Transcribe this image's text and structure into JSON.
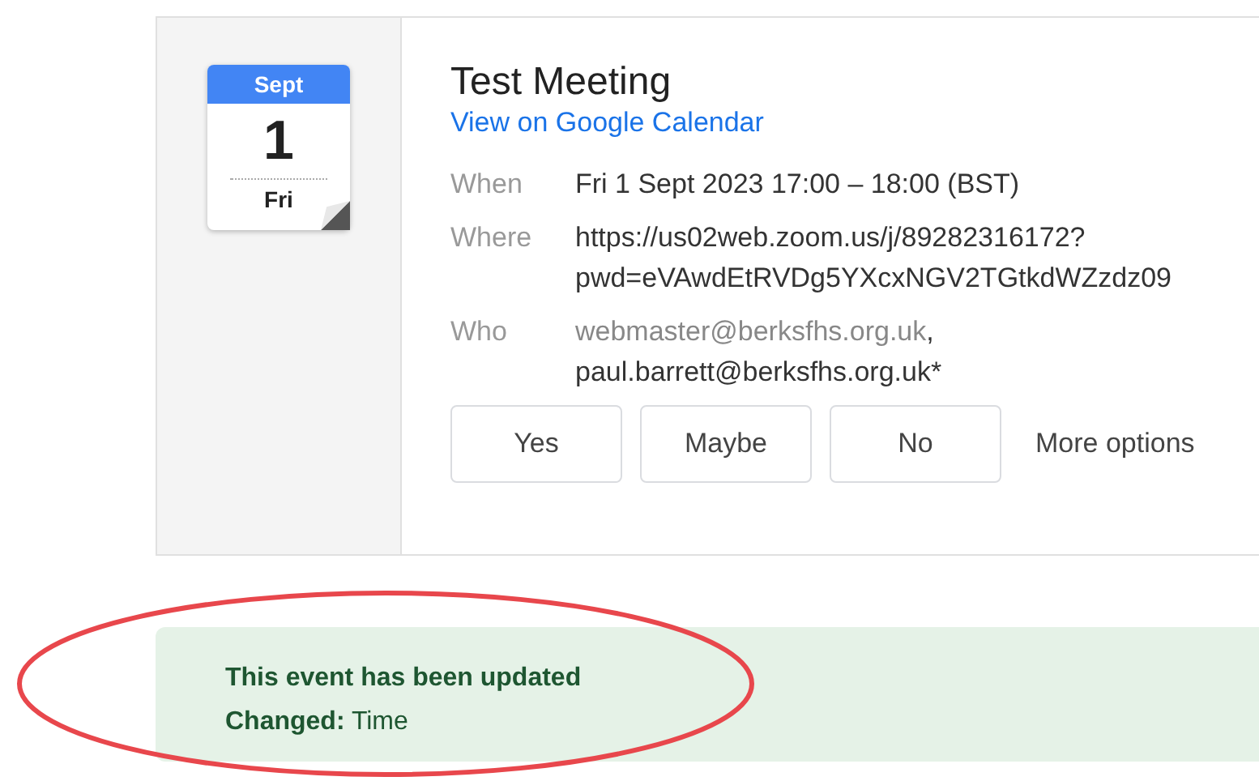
{
  "calendar_icon": {
    "month": "Sept",
    "day": "1",
    "weekday": "Fri"
  },
  "event": {
    "title": "Test Meeting",
    "link": "View on Google Calendar",
    "details": [
      {
        "label": "When",
        "kind": "text",
        "lines": [
          "Fri 1 Sept 2023 17:00 – 18:00 (BST)"
        ]
      },
      {
        "label": "Where",
        "kind": "text",
        "lines": [
          "https://us02web.zoom.us/j/89282316172?",
          "pwd=eVAwdEtRVDg5YXcxNGV2TGtkdWZzdz09"
        ]
      },
      {
        "label": "Who",
        "kind": "guests",
        "guests": [
          {
            "email": "webmaster@berksfhs.org.uk",
            "separator": ",",
            "dimmed": true
          },
          {
            "email": "paul.barrett@berksfhs.org.uk*",
            "dimmed": false
          }
        ]
      }
    ],
    "buttons": [
      {
        "label": "Yes",
        "kind": "outlined"
      },
      {
        "label": "Maybe",
        "kind": "outlined"
      },
      {
        "label": "No",
        "kind": "outlined"
      },
      {
        "label": "More options",
        "kind": "text"
      }
    ]
  },
  "notice": {
    "title": "This event has been updated",
    "change": "**Changed:** Time",
    "highlighted": true
  }
}
